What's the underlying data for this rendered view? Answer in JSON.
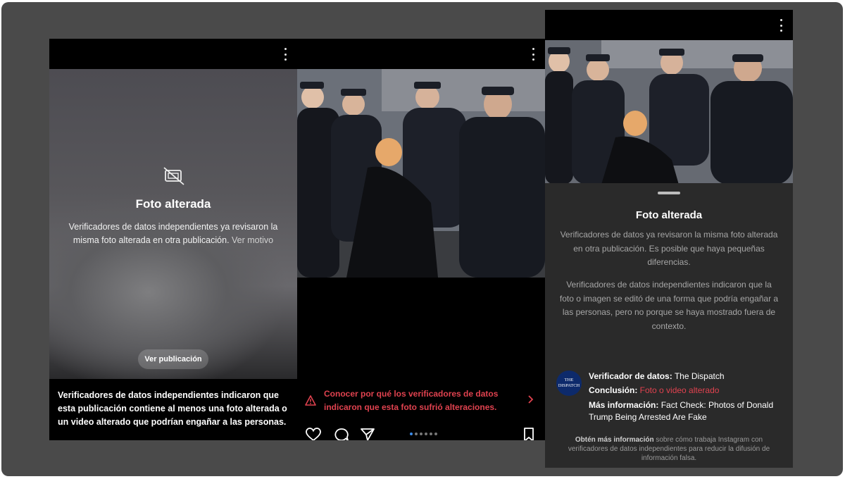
{
  "panel_left": {
    "title": "Foto alterada",
    "description": "Verificadores de datos independientes ya revisaron la misma foto alterada en otra publicación.",
    "see_reason_link": "Ver motivo",
    "view_post_button": "Ver publicación",
    "bottom_text": "Verificadores de datos independientes indicaron que esta publicación contiene al menos una foto alterada o un video alterado que podrían engañar a las personas.",
    "icons": {
      "menu": "more-vertical-icon",
      "hidden_photo": "photo-hidden-icon"
    }
  },
  "panel_middle": {
    "warning_text": "Conocer por qué los verificadores de datos indicaron que esta foto sufrió alteraciones.",
    "carousel": {
      "total": 6,
      "active": 1
    },
    "icons": {
      "warning": "warning-triangle-icon",
      "chevron": "chevron-right-icon",
      "like": "heart-icon",
      "comment": "comment-icon",
      "share": "send-icon",
      "save": "bookmark-icon"
    }
  },
  "panel_right": {
    "sheet_title": "Foto alterada",
    "paragraph_1": "Verificadores de datos ya revisaron la misma foto alterada en otra publicación. Es posible que haya pequeñas diferencias.",
    "paragraph_2": "Verificadores de datos independientes indicaron que la foto o imagen se editó de una forma que podría engañar a las personas, pero no porque se haya mostrado fuera de contexto.",
    "logo_line_1": "THE",
    "logo_line_2": "DISPATCH",
    "checker_label": "Verificador de datos:",
    "checker_value": "The Dispatch",
    "conclusion_label": "Conclusión:",
    "conclusion_value": "Foto o video alterado",
    "more_info_label": "Más información:",
    "more_info_value": "Fact Check: Photos of Donald Trump Being Arrested Are Fake",
    "footer_bold": "Obtén más información",
    "footer_text": "sobre cómo trabaja Instagram con verificadores de datos independientes para reducir la difusión de información falsa."
  },
  "colors": {
    "warning_red": "#e0424f",
    "carousel_active": "#3b8ae8",
    "background": "#4a4a4a"
  }
}
